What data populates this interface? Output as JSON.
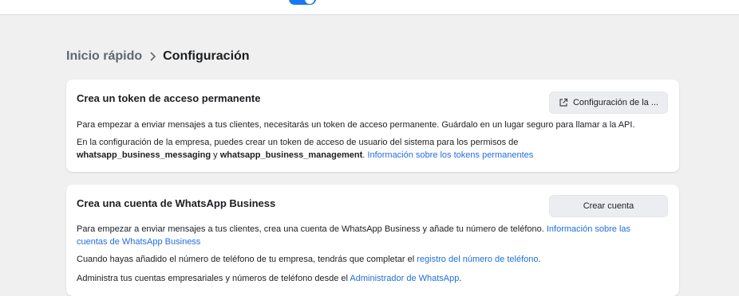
{
  "breadcrumb": {
    "parent": "Inicio rápido",
    "current": "Configuración"
  },
  "token_card": {
    "title": "Crea un token de acceso permanente",
    "button_label": "Configuración de la ...",
    "button_icon": "external-link-icon",
    "para1": "Para empezar a enviar mensajes a tus clientes, necesitarás un token de acceso permanente. Guárdalo en un lugar seguro para llamar a la API.",
    "para2_prefix": "En la configuración de la empresa, puedes crear un token de acceso de usuario del sistema para los permisos de ",
    "perm1": "whatsapp_business_messaging",
    "para2_join": " y ",
    "perm2": "whatsapp_business_management",
    "para2_sep": ". ",
    "link": "Información sobre los tokens permanentes"
  },
  "account_card": {
    "title": "Crea una cuenta de WhatsApp Business",
    "button_label": "Crear cuenta",
    "para1_text": "Para empezar a enviar mensajes a tus clientes, crea una cuenta de WhatsApp Business y añade tu número de teléfono. ",
    "para1_link": "Información sobre las cuentas de WhatsApp Business",
    "para2_text": "Cuando hayas añadido el número de teléfono de tu empresa, tendrás que completar el ",
    "para2_link": "registro del número de teléfono",
    "para2_end": ".",
    "para3_text": "Administra tus cuentas empresariales y números de teléfono desde el ",
    "para3_link": "Administrador de WhatsApp",
    "para3_end": "."
  },
  "colors": {
    "link": "#216fdb",
    "toggle": "#1877f2",
    "background": "#f0f0f0"
  }
}
